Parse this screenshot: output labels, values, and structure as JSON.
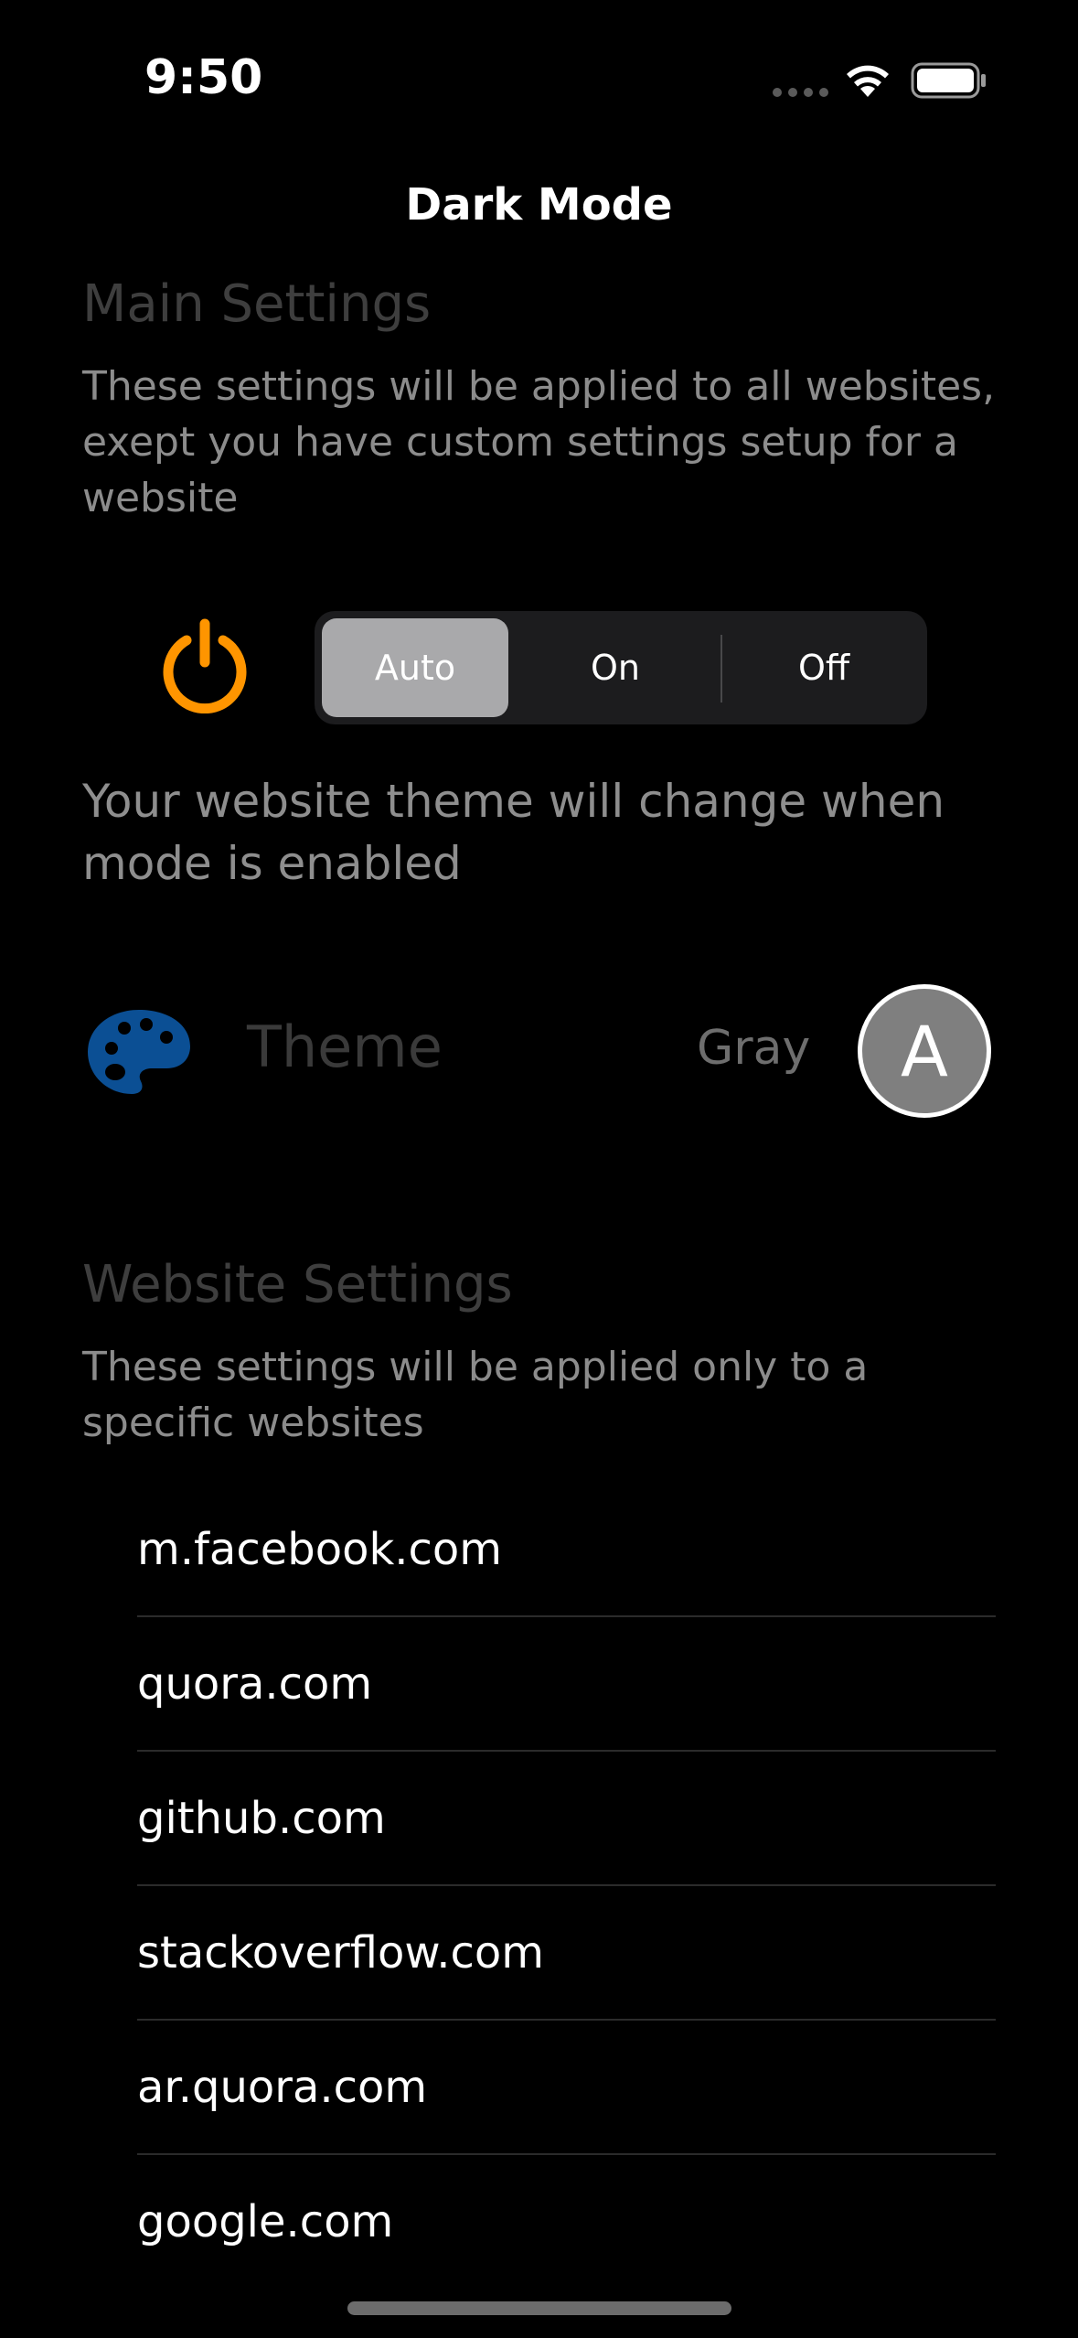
{
  "status_bar": {
    "time": "9:50"
  },
  "nav": {
    "title": "Dark Mode"
  },
  "main_settings": {
    "title": "Main Settings",
    "description": "These settings will be applied to all websites, exept you have custom settings setup for a website"
  },
  "mode_control": {
    "options": [
      "Auto",
      "On",
      "Off"
    ],
    "selected": "Auto",
    "note": "Your website theme will change when mode is enabled"
  },
  "theme": {
    "label": "Theme",
    "value": "Gray",
    "avatar_letter": "A"
  },
  "website_settings": {
    "title": "Website Settings",
    "description": "These settings will be applied only to a specific websites",
    "sites": [
      "m.facebook.com",
      "quora.com",
      "github.com",
      "stackoverflow.com",
      "ar.quora.com",
      "google.com"
    ]
  },
  "colors": {
    "background": "#000000",
    "power_accent": "#ff9500",
    "palette_blue": "#0b4f94",
    "segment_selected": "#a9a9ab"
  },
  "icons": {
    "signal": "signal-dots-icon",
    "wifi": "wifi-icon",
    "battery": "battery-icon",
    "power": "power-icon",
    "palette": "palette-icon"
  }
}
